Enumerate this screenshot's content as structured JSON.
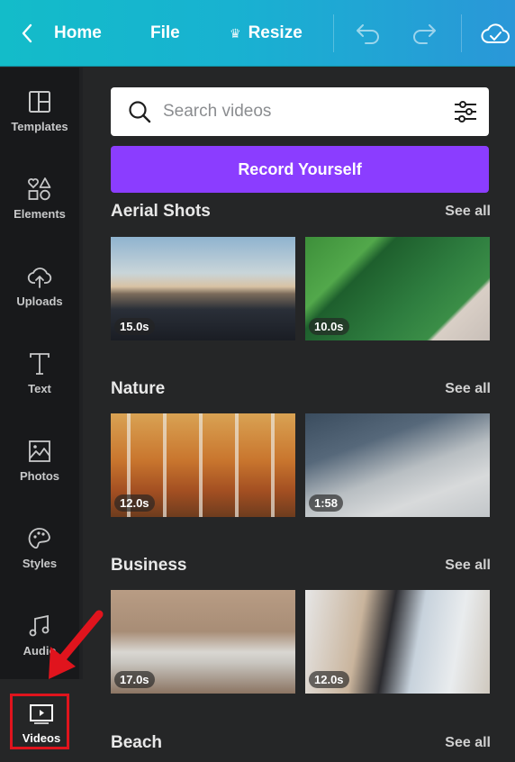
{
  "header": {
    "back_icon": "chevron-left-icon",
    "home_label": "Home",
    "file_label": "File",
    "resize_icon": "crown-icon",
    "resize_label": "Resize",
    "undo_icon": "undo-icon",
    "redo_icon": "redo-icon",
    "cloud_icon": "cloud-check-icon"
  },
  "sidebar": {
    "items": [
      {
        "label": "Templates",
        "icon": "templates-icon"
      },
      {
        "label": "Elements",
        "icon": "elements-icon"
      },
      {
        "label": "Uploads",
        "icon": "upload-cloud-icon"
      },
      {
        "label": "Text",
        "icon": "text-icon"
      },
      {
        "label": "Photos",
        "icon": "photo-icon"
      },
      {
        "label": "Styles",
        "icon": "palette-icon"
      },
      {
        "label": "Audio",
        "icon": "music-note-icon"
      },
      {
        "label": "Videos",
        "icon": "video-icon",
        "active": true
      }
    ]
  },
  "panel": {
    "search": {
      "placeholder": "Search videos",
      "value": ""
    },
    "record_button": "Record Yourself",
    "sections": [
      {
        "title": "Aerial Shots",
        "see_all": "See all",
        "videos": [
          {
            "duration": "15.0s",
            "subject": "bridge"
          },
          {
            "duration": "10.0s",
            "subject": "green field"
          }
        ]
      },
      {
        "title": "Nature",
        "see_all": "See all",
        "videos": [
          {
            "duration": "12.0s",
            "subject": "autumn birch forest"
          },
          {
            "duration": "1:58",
            "subject": "foggy forest"
          }
        ]
      },
      {
        "title": "Business",
        "see_all": "See all",
        "videos": [
          {
            "duration": "17.0s",
            "subject": "typing on keyboard"
          },
          {
            "duration": "12.0s",
            "subject": "typing on laptop"
          }
        ]
      },
      {
        "title": "Beach",
        "see_all": "See all",
        "videos": []
      }
    ]
  },
  "colors": {
    "header_start": "#13bcc9",
    "header_end": "#2a97d8",
    "sidebar_bg": "#18191b",
    "panel_bg": "#252627",
    "record_button": "#8b3dff",
    "annotation": "#e0141d"
  }
}
